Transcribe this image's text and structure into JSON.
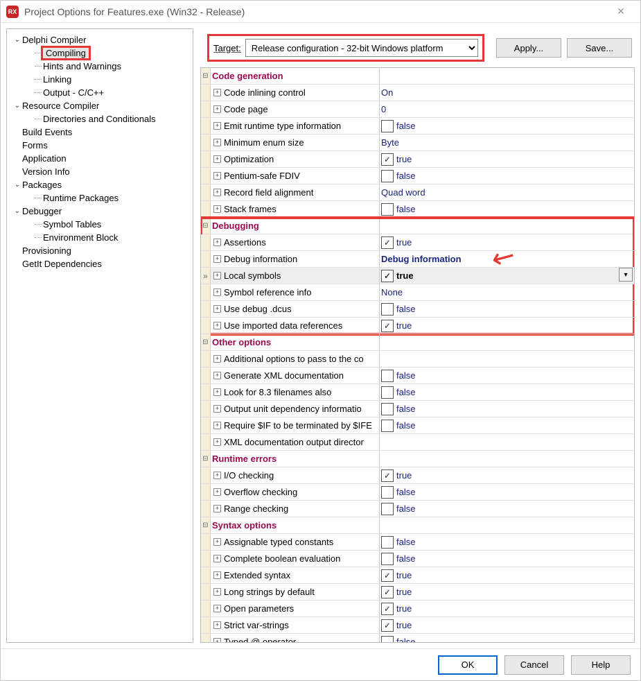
{
  "title": "Project Options for Features.exe  (Win32 - Release)",
  "app_icon_text": "RX",
  "tree": [
    {
      "level": 0,
      "exp": "v",
      "label": "Delphi Compiler"
    },
    {
      "level": 1,
      "label": "Compiling",
      "selected": true,
      "highlight": true
    },
    {
      "level": 1,
      "label": "Hints and Warnings"
    },
    {
      "level": 1,
      "label": "Linking"
    },
    {
      "level": 1,
      "label": "Output - C/C++"
    },
    {
      "level": 0,
      "exp": "v",
      "label": "Resource Compiler"
    },
    {
      "level": 1,
      "label": "Directories and Conditionals"
    },
    {
      "level": 0,
      "label": "Build Events"
    },
    {
      "level": 0,
      "label": "Forms"
    },
    {
      "level": 0,
      "label": "Application"
    },
    {
      "level": 0,
      "label": "Version Info"
    },
    {
      "level": 0,
      "exp": "v",
      "label": "Packages"
    },
    {
      "level": 1,
      "label": "Runtime Packages"
    },
    {
      "level": 0,
      "exp": "v",
      "label": "Debugger"
    },
    {
      "level": 1,
      "label": "Symbol Tables"
    },
    {
      "level": 1,
      "label": "Environment Block"
    },
    {
      "level": 0,
      "label": "Provisioning"
    },
    {
      "level": 0,
      "label": "GetIt Dependencies"
    }
  ],
  "target": {
    "label": "Target:",
    "value": "Release configuration - 32-bit Windows platform"
  },
  "buttons": {
    "apply": "Apply...",
    "save": "Save...",
    "ok": "OK",
    "cancel": "Cancel",
    "help": "Help"
  },
  "groups": [
    {
      "title": "Code generation",
      "items": [
        {
          "name": "Code inlining control",
          "value": "On"
        },
        {
          "name": "Code page",
          "value": "0"
        },
        {
          "name": "Emit runtime type information",
          "value": "false",
          "check": false
        },
        {
          "name": "Minimum enum size",
          "value": "Byte"
        },
        {
          "name": "Optimization",
          "value": "true",
          "check": true
        },
        {
          "name": "Pentium-safe FDIV",
          "value": "false",
          "check": false
        },
        {
          "name": "Record field alignment",
          "value": "Quad word"
        },
        {
          "name": "Stack frames",
          "value": "false",
          "check": false
        }
      ]
    },
    {
      "title": "Debugging",
      "highlight": true,
      "items": [
        {
          "name": "Assertions",
          "value": "true",
          "check": true
        },
        {
          "name": "Debug information",
          "value": "Debug information",
          "boldBlue": true,
          "arrow": true
        },
        {
          "name": "Local symbols",
          "value": "true",
          "check": true,
          "selected": true,
          "dropdown": true
        },
        {
          "name": "Symbol reference info",
          "value": "None"
        },
        {
          "name": "Use debug .dcus",
          "value": "false",
          "check": false
        },
        {
          "name": "Use imported data references",
          "value": "true",
          "check": true
        }
      ]
    },
    {
      "title": "Other options",
      "items": [
        {
          "name": "Additional options to pass to the co",
          "value": ""
        },
        {
          "name": "Generate XML documentation",
          "value": "false",
          "check": false
        },
        {
          "name": "Look for 8.3 filenames also",
          "value": "false",
          "check": false
        },
        {
          "name": "Output unit dependency informatio",
          "value": "false",
          "check": false
        },
        {
          "name": "Require $IF to be terminated by $IFE",
          "value": "false",
          "check": false
        },
        {
          "name": "XML documentation output director",
          "value": ""
        }
      ]
    },
    {
      "title": "Runtime errors",
      "items": [
        {
          "name": "I/O checking",
          "value": "true",
          "check": true
        },
        {
          "name": "Overflow checking",
          "value": "false",
          "check": false
        },
        {
          "name": "Range checking",
          "value": "false",
          "check": false
        }
      ]
    },
    {
      "title": "Syntax options",
      "items": [
        {
          "name": "Assignable typed constants",
          "value": "false",
          "check": false
        },
        {
          "name": "Complete boolean evaluation",
          "value": "false",
          "check": false
        },
        {
          "name": "Extended syntax",
          "value": "true",
          "check": true
        },
        {
          "name": "Long strings by default",
          "value": "true",
          "check": true
        },
        {
          "name": "Open parameters",
          "value": "true",
          "check": true
        },
        {
          "name": "Strict var-strings",
          "value": "true",
          "check": true
        },
        {
          "name": "Typed @ operator",
          "value": "false",
          "check": false
        }
      ]
    }
  ]
}
